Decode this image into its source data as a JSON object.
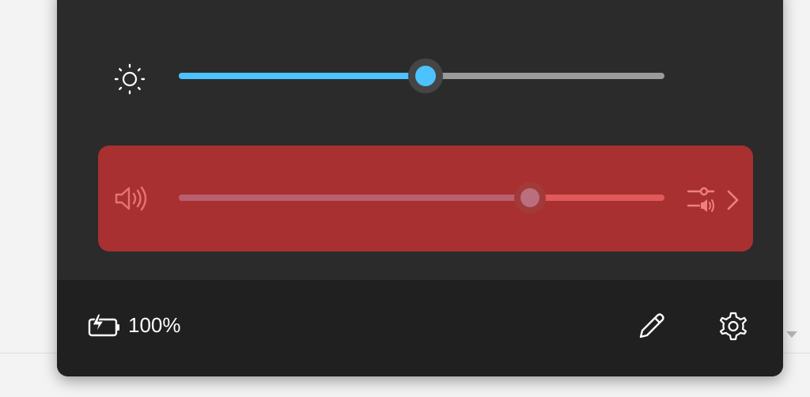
{
  "quick_settings": {
    "brightness": {
      "icon": "sun-icon",
      "level": 0.5,
      "fill_color": "#4cc2ff",
      "track_color": "#9a9a9a"
    },
    "volume": {
      "icon": "speaker-icon",
      "level": 0.72,
      "muted_highlight_color": "#a83030",
      "manage_audio_icon": "audio-mixer-icon",
      "expand_icon": "chevron-right-icon"
    },
    "footer": {
      "battery_icon": "battery-charging-icon",
      "battery_percent": "100%",
      "edit_icon": "pencil-icon",
      "settings_icon": "gear-icon"
    }
  }
}
